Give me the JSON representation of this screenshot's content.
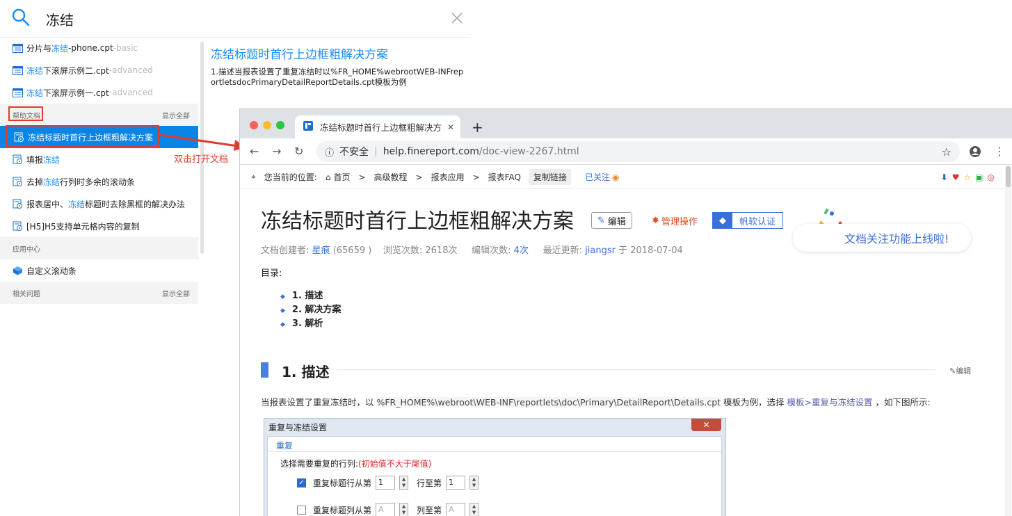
{
  "search": {
    "query": "冻结"
  },
  "results": {
    "templates": [
      {
        "pre": "分片与",
        "hit": "冻结",
        "post": "-phone.cpt",
        "tag": "-basic"
      },
      {
        "pre": "",
        "hit": "冻结",
        "post": "下滚屏示例二.cpt",
        "tag": "-advanced"
      },
      {
        "pre": "",
        "hit": "冻结",
        "post": "下滚屏示例一.cpt",
        "tag": "-advanced"
      }
    ],
    "help_section": {
      "label": "帮助文档",
      "show_all": "显示全部"
    },
    "help_items": [
      {
        "pre": "",
        "hit": "冻结标题时首行上边框粗解决方案",
        "post": ""
      },
      {
        "pre": "填报",
        "hit": "冻结",
        "post": ""
      },
      {
        "pre": "去掉",
        "hit": "冻结",
        "post": "行列时多余的滚动条"
      },
      {
        "pre": "报表居中、",
        "hit": "冻结",
        "post": "标题时去除黑框的解决办法"
      },
      {
        "pre": "[H5]H5支持单元格内容的复制",
        "hit": "",
        "post": ""
      }
    ],
    "app_section": {
      "label": "应用中心"
    },
    "app_items": [
      {
        "label": "自定义滚动条"
      }
    ],
    "related_section": {
      "label": "相关问题",
      "show_all": "显示全部"
    }
  },
  "preview": {
    "title": "冻结标题时首行上边框粗解决方案",
    "body": "1.描述当报表设置了重复冻结时以%FR_HOME%webrootWEB-INFreportletsdocPrimaryDetailReportDetails.cpt模板为例"
  },
  "annotation": {
    "text": "双击打开文档"
  },
  "browser": {
    "tab_title": "冻结标题时首行上边框粗解决方",
    "insecure": "不安全",
    "url_host": "help.finereport.com",
    "url_path": "/doc-view-2267.html",
    "crumbs": {
      "label": "您当前的位置:",
      "home": "首页",
      "c1": "高级教程",
      "c2": "报表应用",
      "c3": "报表FAQ",
      "copy": "复制链接",
      "follow": "已关注"
    },
    "doc_title": "冻结标题时首行上边框粗解决方案",
    "edit_btn": "编辑",
    "manage_btn": "管理操作",
    "cert_btn": "帆软认证",
    "meta": {
      "creator_label": "文档创建者:",
      "creator": "星痕",
      "creator_id": "(65659 )",
      "views_label": "浏览次数:",
      "views": "2618次",
      "edits_label": "编辑次数:",
      "edits": "4次",
      "updated_label": "最近更新:",
      "updater": "jiangsr",
      "updated_on": "于 2018-07-04"
    },
    "banner": "文档关注功能上线啦!",
    "toc_heading": "目录:",
    "toc": [
      "1. 描述",
      "2. 解决方案",
      "3. 解析"
    ],
    "section_heading": "1. 描述",
    "section_edit": "编辑",
    "para": {
      "pre": "当报表设置了重复冻结时，以 ",
      "code": "%FR_HOME%\\webroot\\WEB-INF\\reportlets\\doc\\Primary\\DetailReport\\Details.cpt",
      "mid": " 模板为例，选择 ",
      "link": "模板>重复与冻结设置",
      "post": " ，如下图所示:"
    },
    "dialog": {
      "title": "重复与冻结设置",
      "close": "✕",
      "tab": "重复",
      "note": "选择需要重复的行列:",
      "note_red": "(初始值不大于尾值)",
      "row1": {
        "label": "重复标题行从第",
        "from": "1",
        "to_label": "行至第",
        "to": "1",
        "checked": true
      },
      "row2": {
        "label": "重复标题列从第",
        "from": "A",
        "to_label": "列至第",
        "to": "A",
        "checked": false
      }
    }
  },
  "colors": {
    "accent": "#0a84e6",
    "highlight": "#1a8cff",
    "annotation": "#e03b2e"
  }
}
